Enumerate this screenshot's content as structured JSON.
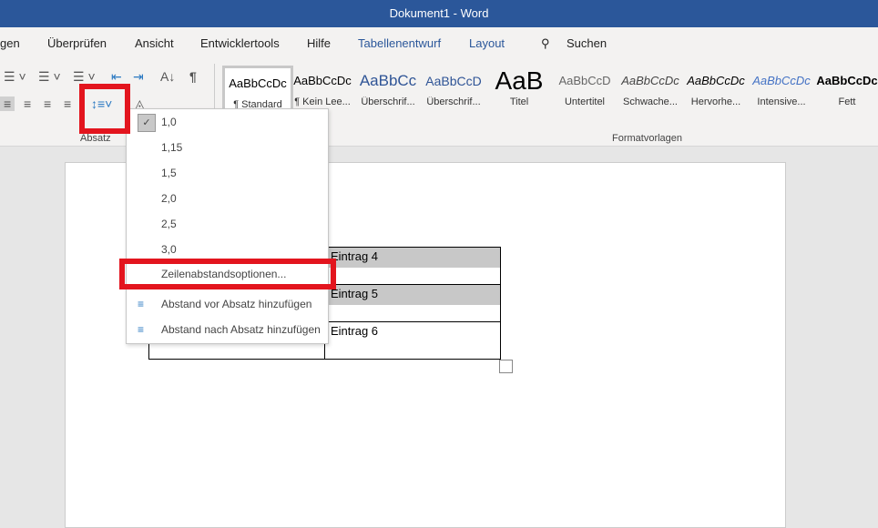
{
  "title": "Dokument1  -  Word",
  "tabs": [
    "gen",
    "Überprüfen",
    "Ansicht",
    "Entwicklertools",
    "Hilfe",
    "Tabellenentwurf",
    "Layout"
  ],
  "search_label": "Suchen",
  "groups": {
    "absatz": "Absatz",
    "formatvorlagen": "Formatvorlagen"
  },
  "styles": [
    {
      "preview": "AaBbCcDc",
      "label": "¶ Standard"
    },
    {
      "preview": "AaBbCcDc",
      "label": "¶ Kein Lee..."
    },
    {
      "preview": "AaBbCc",
      "label": "Überschrif..."
    },
    {
      "preview": "AaBbCcD",
      "label": "Überschrif..."
    },
    {
      "preview": "AaB",
      "label": "Titel"
    },
    {
      "preview": "AaBbCcD",
      "label": "Untertitel"
    },
    {
      "preview": "AaBbCcDc",
      "label": "Schwache..."
    },
    {
      "preview": "AaBbCcDc",
      "label": "Hervorhe..."
    },
    {
      "preview": "AaBbCcDc",
      "label": "Intensive..."
    },
    {
      "preview": "AaBbCcDc",
      "label": "Fett"
    }
  ],
  "menu": {
    "options": [
      "1,0",
      "1,15",
      "1,5",
      "2,0",
      "2,5",
      "3,0"
    ],
    "selected": "1,0",
    "options_link": "Zeilenabstandsoptionen...",
    "before": "Abstand vor Absatz hinzufügen",
    "after": "Abstand nach Absatz hinzufügen"
  },
  "table": [
    "Eintrag 4",
    "Eintrag 5",
    "Eintrag 6"
  ],
  "colors": {
    "brand": "#2b579a",
    "highlight": "#e3151e"
  }
}
